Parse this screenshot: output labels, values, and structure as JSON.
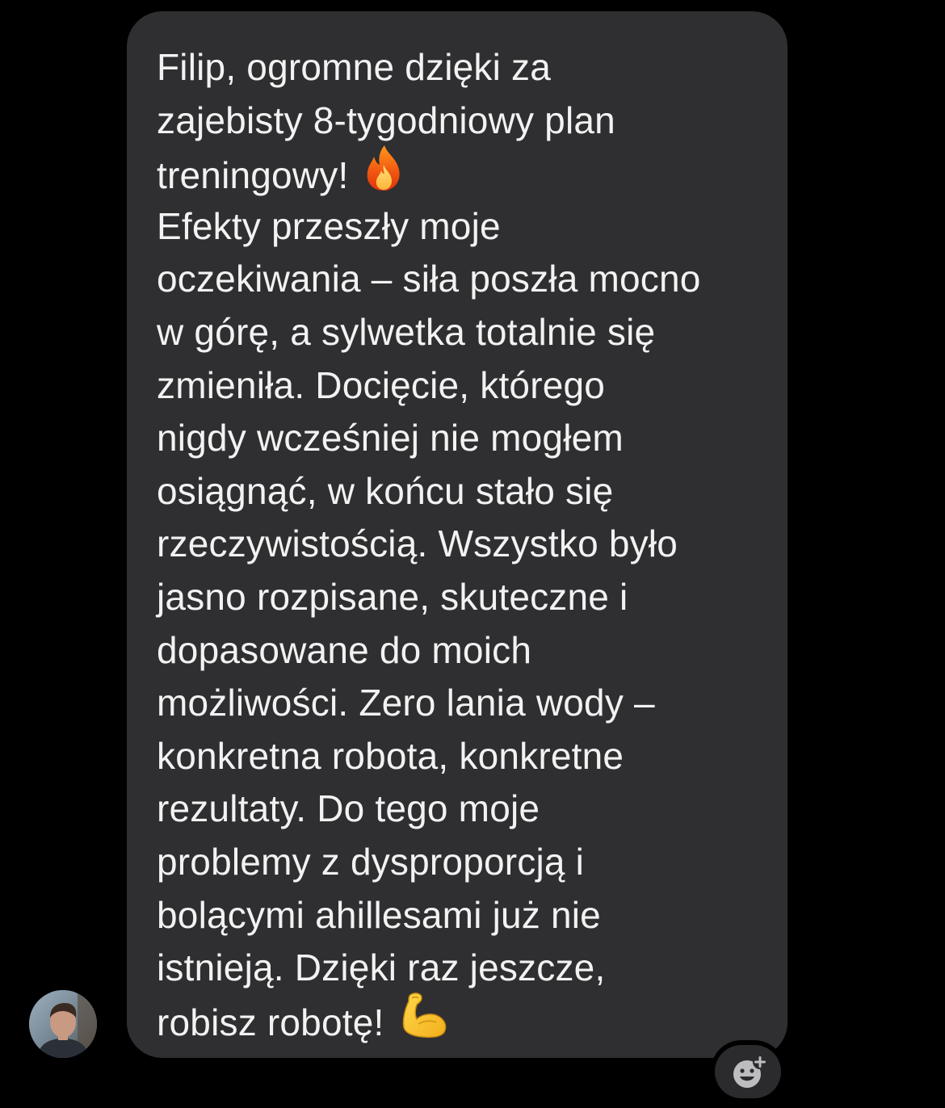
{
  "message": {
    "lines": [
      "Filip, ogromne dzięki za",
      "zajebisty 8-tygodniowy plan",
      "treningowy!",
      "Efekty przeszły moje",
      "oczekiwania – siła poszła mocno",
      "w górę, a sylwetka totalnie się",
      "zmieniła. Docięcie, którego",
      "nigdy wcześniej nie mogłem",
      "osiągnąć, w końcu stało się",
      "rzeczywistością. Wszystko było",
      "jasno rozpisane, skuteczne i",
      "dopasowane do moich",
      "możliwości. Zero lania wody –",
      "konkretna robota, konkretne",
      "rezultaty. Do tego moje",
      "problemy z dysproporcją i",
      "bolącymi ahillesami już nie",
      "istnieją. Dzięki raz jeszcze,",
      "robisz robotę!"
    ],
    "emojis": {
      "line_3": "fire-icon",
      "line_19": "flexed-biceps-icon"
    }
  },
  "sender": {
    "avatar_icon": "avatar"
  },
  "reaction": {
    "icon": "add-reaction-icon"
  },
  "colors": {
    "background": "#000000",
    "bubble": "#2f2f31",
    "text": "#f2f2f2",
    "reaction_button": "#2b2b2d"
  }
}
